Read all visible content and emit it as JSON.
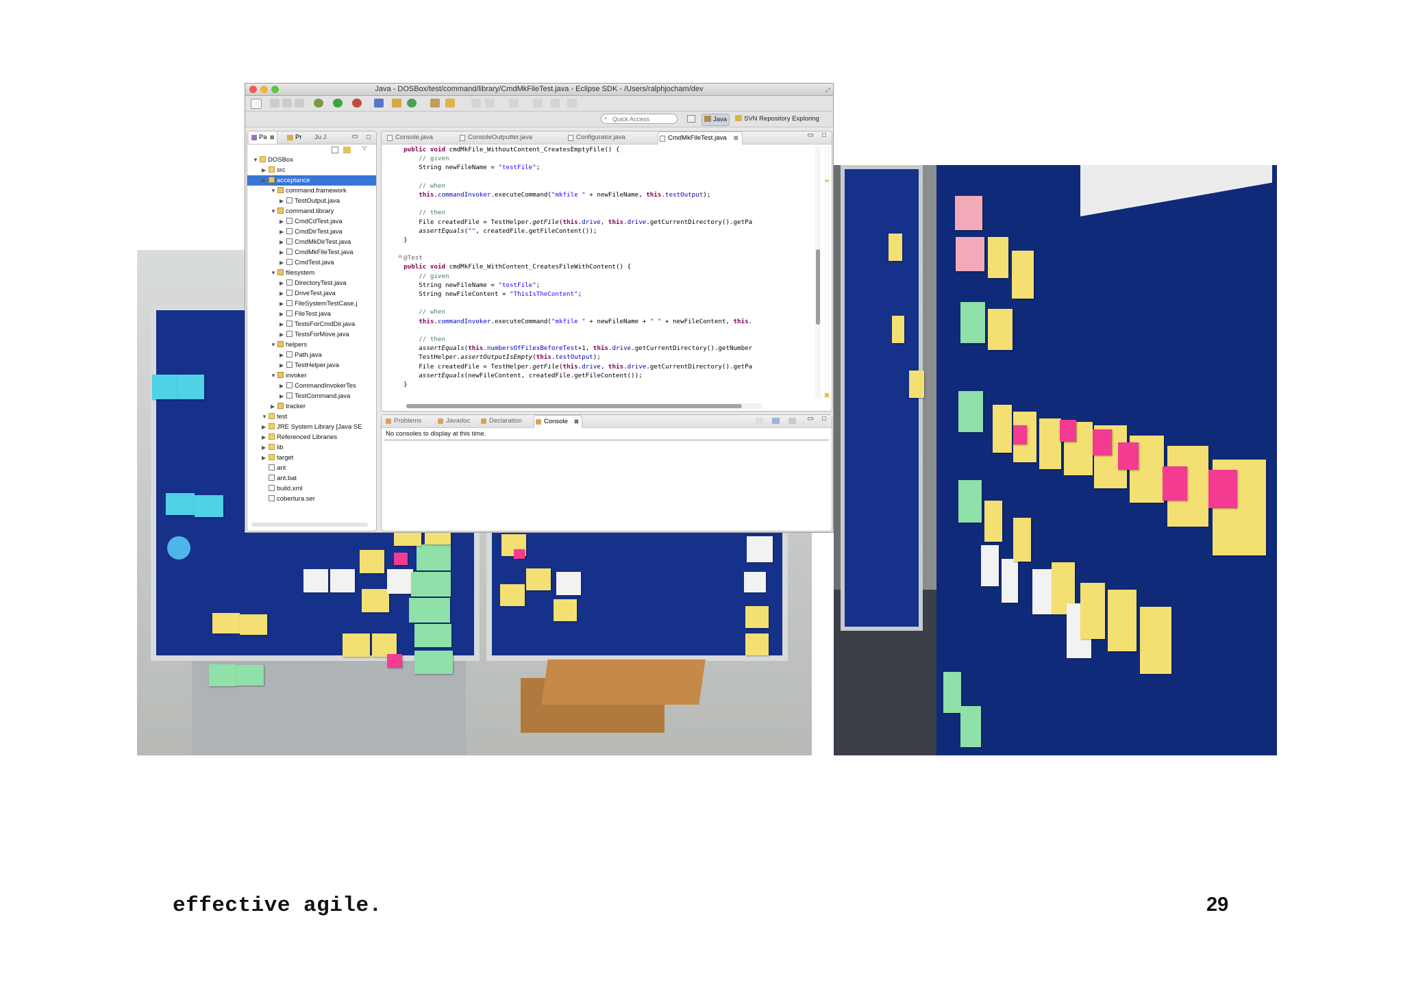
{
  "window": {
    "title": "Java - DOSBox/test/command/library/CmdMkFileTest.java - Eclipse SDK - /Users/ralphjocham/dev",
    "quick_access_placeholder": "Quick Access",
    "perspectives": [
      "Java",
      "SVN Repository Exploring"
    ]
  },
  "package_explorer": {
    "tabs": [
      "Pa",
      "Pr",
      "Ju J"
    ],
    "tree": [
      {
        "label": "DOSBox",
        "depth": 0,
        "kind": "project",
        "expanded": true
      },
      {
        "label": "src",
        "depth": 1,
        "kind": "folder"
      },
      {
        "label": "acceptance",
        "depth": 1,
        "kind": "package",
        "selected": true
      },
      {
        "label": "command.framework",
        "depth": 2,
        "kind": "package",
        "expanded": true
      },
      {
        "label": "TestOutput.java",
        "depth": 3,
        "kind": "file"
      },
      {
        "label": "command.library",
        "depth": 2,
        "kind": "package",
        "expanded": true
      },
      {
        "label": "CmdCdTest.java",
        "depth": 3,
        "kind": "file"
      },
      {
        "label": "CmdDirTest.java",
        "depth": 3,
        "kind": "file"
      },
      {
        "label": "CmdMkDirTest.java",
        "depth": 3,
        "kind": "file"
      },
      {
        "label": "CmdMkFileTest.java",
        "depth": 3,
        "kind": "file"
      },
      {
        "label": "CmdTest.java",
        "depth": 3,
        "kind": "file"
      },
      {
        "label": "filesystem",
        "depth": 2,
        "kind": "package",
        "expanded": true
      },
      {
        "label": "DirectoryTest.java",
        "depth": 3,
        "kind": "file"
      },
      {
        "label": "DriveTest.java",
        "depth": 3,
        "kind": "file"
      },
      {
        "label": "FileSystemTestCase.j",
        "depth": 3,
        "kind": "file"
      },
      {
        "label": "FileTest.java",
        "depth": 3,
        "kind": "file"
      },
      {
        "label": "TestsForCmdDir.java",
        "depth": 3,
        "kind": "file"
      },
      {
        "label": "TestsForMove.java",
        "depth": 3,
        "kind": "file"
      },
      {
        "label": "helpers",
        "depth": 2,
        "kind": "package",
        "expanded": true
      },
      {
        "label": "Path.java",
        "depth": 3,
        "kind": "file"
      },
      {
        "label": "TestHelper.java",
        "depth": 3,
        "kind": "file"
      },
      {
        "label": "invoker",
        "depth": 2,
        "kind": "package",
        "expanded": true
      },
      {
        "label": "CommandInvokerTes",
        "depth": 3,
        "kind": "file"
      },
      {
        "label": "TestCommand.java",
        "depth": 3,
        "kind": "file"
      },
      {
        "label": "tracker",
        "depth": 2,
        "kind": "package"
      },
      {
        "label": "test",
        "depth": 1,
        "kind": "folder",
        "expanded": true
      },
      {
        "label": "JRE System Library [Java SE",
        "depth": 1,
        "kind": "library"
      },
      {
        "label": "Referenced Libraries",
        "depth": 1,
        "kind": "library"
      },
      {
        "label": "lib",
        "depth": 1,
        "kind": "folder"
      },
      {
        "label": "target",
        "depth": 1,
        "kind": "folder"
      },
      {
        "label": "ant",
        "depth": 1,
        "kind": "file"
      },
      {
        "label": "ant.bat",
        "depth": 1,
        "kind": "file"
      },
      {
        "label": "build.xml",
        "depth": 1,
        "kind": "file"
      },
      {
        "label": "cobertura.ser",
        "depth": 1,
        "kind": "file"
      }
    ]
  },
  "editor": {
    "tabs": [
      "Console.java",
      "ConsoleOutputter.java",
      "Configurator.java",
      "CmdMkFileTest.java"
    ],
    "active_tab": 3,
    "lines": [
      "    public void cmdMkFile_WithoutContent_CreatesEmptyFile() {",
      "        // given",
      "        String newFileName = \"testFile\";",
      "",
      "        // when",
      "        this.commandInvoker.executeCommand(\"mkfile \" + newFileName, this.testOutput);",
      "",
      "        // then",
      "        File createdFile = TestHelper.getFile(this.drive, this.drive.getCurrentDirectory().getPa",
      "        assertEquals(\"\", createdFile.getFileContent());",
      "    }",
      "",
      "    @Test",
      "    public void cmdMkFile_WithContent_CreatesFileWithContent() {",
      "        // given",
      "        String newFileName = \"testFile\";",
      "        String newFileContent = \"ThisIsTheContent\";",
      "",
      "        // when",
      "        this.commandInvoker.executeCommand(\"mkfile \" + newFileName + \" \" + newFileContent, this.",
      "",
      "        // then",
      "        assertEquals(this.numbersOfFilesBeforeTest+1, this.drive.getCurrentDirectory().getNumber",
      "        TestHelper.assertOutputIsEmpty(this.testOutput);",
      "        File createdFile = TestHelper.getFile(this.drive, this.drive.getCurrentDirectory().getPa",
      "        assertEquals(newFileContent, createdFile.getFileContent());",
      "    }"
    ]
  },
  "bottom_panel": {
    "tabs": [
      "Problems",
      "Javadoc",
      "Declaration",
      "Console"
    ],
    "active_tab": 3,
    "console_message": "No consoles to display at this time."
  },
  "slide": {
    "footer_title": "effective agile.",
    "page_number": "29"
  },
  "colors": {
    "board_blue": "#15318a",
    "note_yellow": "#f4df72",
    "note_pink": "#f33b92",
    "note_green": "#8fe0a9",
    "selection_blue": "#3875d7"
  }
}
